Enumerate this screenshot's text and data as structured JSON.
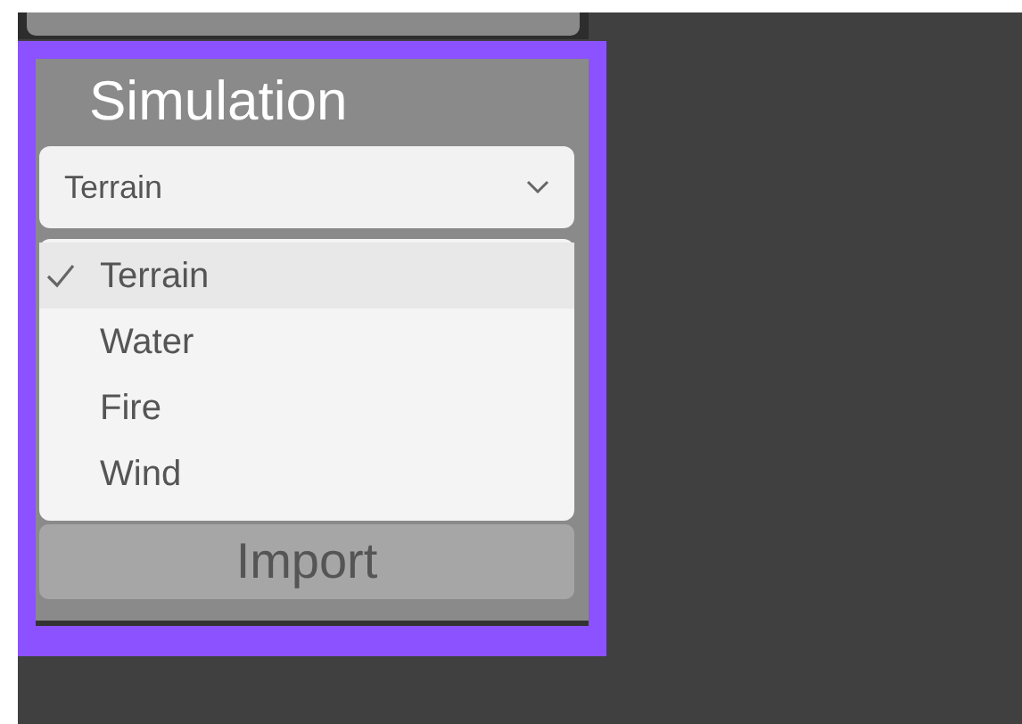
{
  "panel": {
    "title": "Simulation",
    "dropdown": {
      "value": "Terrain",
      "expanded": true,
      "options": [
        {
          "label": "Terrain",
          "selected": true
        },
        {
          "label": "Water",
          "selected": false
        },
        {
          "label": "Fire",
          "selected": false
        },
        {
          "label": "Wind",
          "selected": false
        }
      ]
    },
    "button": "Import",
    "highlighted": true
  }
}
